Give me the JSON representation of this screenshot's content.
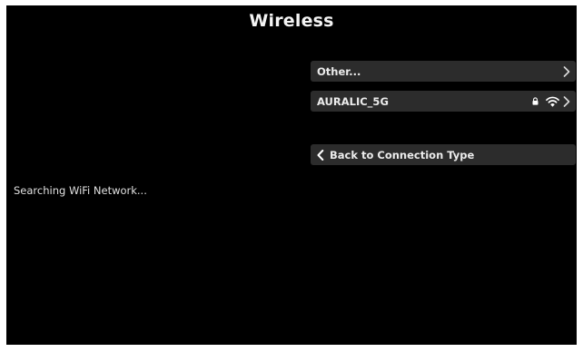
{
  "header": {
    "title": "Wireless"
  },
  "status": {
    "text": "Searching WiFi Network..."
  },
  "networks": [
    {
      "name": "Other...",
      "locked": false,
      "signal": false
    },
    {
      "name": "AURALIC_5G",
      "locked": true,
      "signal": true
    }
  ],
  "back": {
    "label": "Back to Connection Type"
  },
  "icons": {
    "chevron": "chevron-right-icon",
    "lock": "lock-icon",
    "wifi": "wifi-icon",
    "back": "chevron-left-icon"
  },
  "colors": {
    "background": "#000000",
    "row_background": "#2c2c2c",
    "text": "#ececec"
  }
}
